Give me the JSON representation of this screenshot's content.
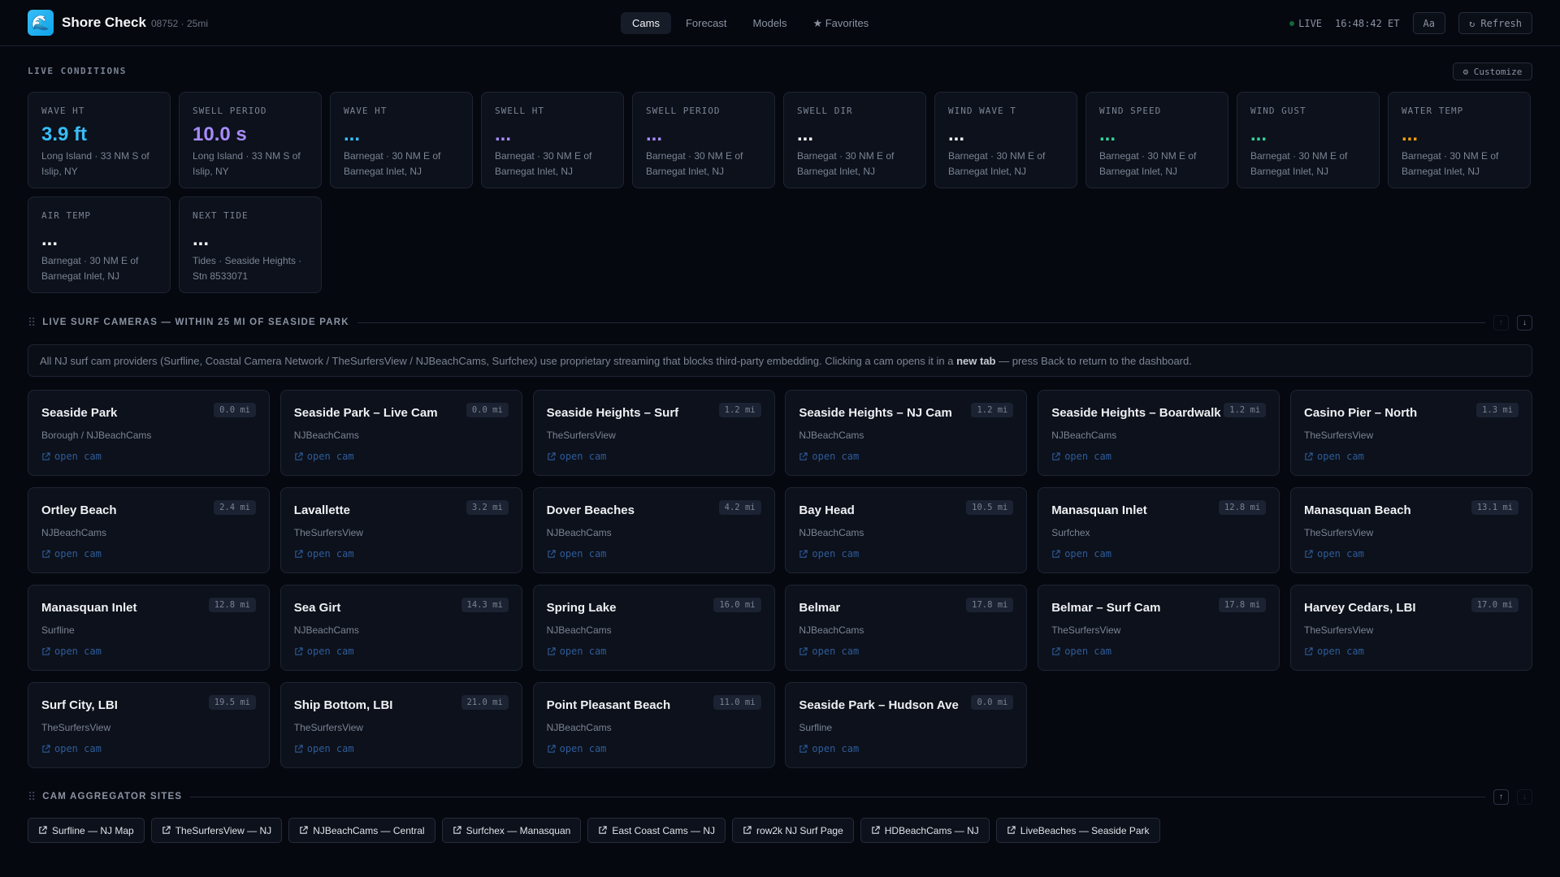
{
  "header": {
    "title": "Shore Check",
    "subtitle": "08752 · 25mi",
    "logo_icon": "wave-icon",
    "tabs": [
      {
        "label": "Cams",
        "active": true
      },
      {
        "label": "Forecast"
      },
      {
        "label": "Models"
      },
      {
        "label": "★ Favorites"
      }
    ],
    "live_label": "LIVE",
    "time": "16:48:42 ET",
    "font_button": "Aa",
    "refresh_button": "↻ Refresh"
  },
  "conditions": {
    "title": "LIVE CONDITIONS",
    "customize": "⚙ Customize",
    "cards": [
      {
        "label": "WAVE HT",
        "value": "3.9 ft",
        "color": "#38bdf8",
        "desc": "Long Island · 33 NM S of Islip, NY"
      },
      {
        "label": "SWELL PERIOD",
        "value": "10.0 s",
        "color": "#a78bfa",
        "desc": "Long Island · 33 NM S of Islip, NY"
      },
      {
        "label": "WAVE HT",
        "value": "...",
        "color": "#38bdf8",
        "desc": "Barnegat · 30 NM E of Barnegat Inlet, NJ"
      },
      {
        "label": "SWELL HT",
        "value": "...",
        "color": "#a78bfa",
        "desc": "Barnegat · 30 NM E of Barnegat Inlet, NJ"
      },
      {
        "label": "SWELL PERIOD",
        "value": "...",
        "color": "#a78bfa",
        "desc": "Barnegat · 30 NM E of Barnegat Inlet, NJ"
      },
      {
        "label": "SWELL DIR",
        "value": "...",
        "color": "#f3f4f6",
        "desc": "Barnegat · 30 NM E of Barnegat Inlet, NJ"
      },
      {
        "label": "WIND WAVE T",
        "value": "...",
        "color": "#f3f4f6",
        "desc": "Barnegat · 30 NM E of Barnegat Inlet, NJ"
      },
      {
        "label": "WIND SPEED",
        "value": "...",
        "color": "#34d399",
        "desc": "Barnegat · 30 NM E of Barnegat Inlet, NJ"
      },
      {
        "label": "WIND GUST",
        "value": "...",
        "color": "#34d399",
        "desc": "Barnegat · 30 NM E of Barnegat Inlet, NJ"
      },
      {
        "label": "WATER TEMP",
        "value": "...",
        "color": "#f59e0b",
        "desc": "Barnegat · 30 NM E of Barnegat Inlet, NJ"
      },
      {
        "label": "AIR TEMP",
        "value": "...",
        "color": "#f3f4f6",
        "desc": "Barnegat · 30 NM E of Barnegat Inlet, NJ"
      },
      {
        "label": "NEXT TIDE",
        "value": "...",
        "color": "#f3f4f6",
        "desc": "Tides · Seaside Heights · Stn 8533071"
      }
    ]
  },
  "cams": {
    "title": "LIVE SURF CAMERAS — WITHIN 25 MI OF SEASIDE PARK",
    "notice_pre": "All NJ surf cam providers (Surfline, Coastal Camera Network / TheSurfersView / NJBeachCams, Surfchex) use proprietary streaming that blocks third-party embedding. Clicking a cam opens it in a ",
    "notice_bold": "new tab",
    "notice_post": " — press Back to return to the dashboard.",
    "open_label": "open cam",
    "items": [
      {
        "name": "Seaside Park",
        "dist": "0.0 mi",
        "source": "Borough / NJBeachCams"
      },
      {
        "name": "Seaside Park – Live Cam",
        "dist": "0.0 mi",
        "source": "NJBeachCams"
      },
      {
        "name": "Seaside Heights – Surf",
        "dist": "1.2 mi",
        "source": "TheSurfersView"
      },
      {
        "name": "Seaside Heights – NJ Cam",
        "dist": "1.2 mi",
        "source": "NJBeachCams"
      },
      {
        "name": "Seaside Heights – Boardwalk",
        "dist": "1.2 mi",
        "source": "NJBeachCams"
      },
      {
        "name": "Casino Pier – North",
        "dist": "1.3 mi",
        "source": "TheSurfersView"
      },
      {
        "name": "Ortley Beach",
        "dist": "2.4 mi",
        "source": "NJBeachCams"
      },
      {
        "name": "Lavallette",
        "dist": "3.2 mi",
        "source": "TheSurfersView"
      },
      {
        "name": "Dover Beaches",
        "dist": "4.2 mi",
        "source": "NJBeachCams"
      },
      {
        "name": "Bay Head",
        "dist": "10.5 mi",
        "source": "NJBeachCams"
      },
      {
        "name": "Manasquan Inlet",
        "dist": "12.8 mi",
        "source": "Surfchex"
      },
      {
        "name": "Manasquan Beach",
        "dist": "13.1 mi",
        "source": "TheSurfersView"
      },
      {
        "name": "Manasquan Inlet",
        "dist": "12.8 mi",
        "source": "Surfline"
      },
      {
        "name": "Sea Girt",
        "dist": "14.3 mi",
        "source": "NJBeachCams"
      },
      {
        "name": "Spring Lake",
        "dist": "16.0 mi",
        "source": "NJBeachCams"
      },
      {
        "name": "Belmar",
        "dist": "17.8 mi",
        "source": "NJBeachCams"
      },
      {
        "name": "Belmar – Surf Cam",
        "dist": "17.8 mi",
        "source": "TheSurfersView"
      },
      {
        "name": "Harvey Cedars, LBI",
        "dist": "17.0 mi",
        "source": "TheSurfersView"
      },
      {
        "name": "Surf City, LBI",
        "dist": "19.5 mi",
        "source": "TheSurfersView"
      },
      {
        "name": "Ship Bottom, LBI",
        "dist": "21.0 mi",
        "source": "TheSurfersView"
      },
      {
        "name": "Point Pleasant Beach",
        "dist": "11.0 mi",
        "source": "NJBeachCams"
      },
      {
        "name": "Seaside Park – Hudson Ave",
        "dist": "0.0 mi",
        "source": "Surfline"
      }
    ]
  },
  "aggregators": {
    "title": "CAM AGGREGATOR SITES",
    "items": [
      "Surfline — NJ Map",
      "TheSurfersView — NJ",
      "NJBeachCams — Central",
      "Surfchex — Manasquan",
      "East Coast Cams — NJ",
      "row2k NJ Surf Page",
      "HDBeachCams — NJ",
      "LiveBeaches — Seaside Park"
    ]
  }
}
